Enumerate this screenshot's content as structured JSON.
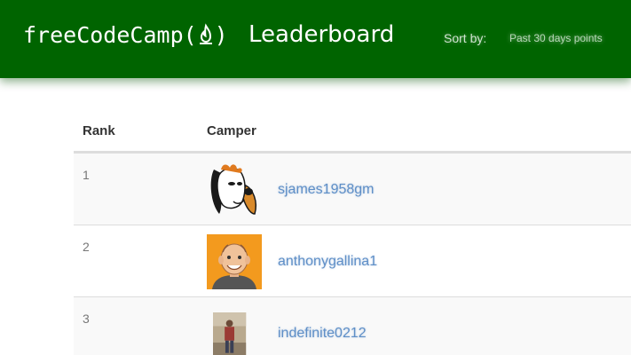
{
  "header": {
    "brand_prefix": "freeCodeCamp(",
    "brand_suffix_paren": ")",
    "brand_title": "Leaderboard",
    "sort_label": "Sort by:",
    "sort_option": "Past 30 days points",
    "brand_color": "#006400",
    "flame_icon": "fire-icon"
  },
  "table": {
    "headers": {
      "rank": "Rank",
      "camper": "Camper"
    },
    "rows": [
      {
        "rank": "1",
        "username": "sjames1958gm",
        "avatar_icon": "cartoon-dog-avatar"
      },
      {
        "rank": "2",
        "username": "anthonygallina1",
        "avatar_icon": "cartoon-man-avatar"
      },
      {
        "rank": "3",
        "username": "indefinite0212",
        "avatar_icon": "photo-person-avatar"
      }
    ],
    "link_color": "#5f8fc7"
  }
}
